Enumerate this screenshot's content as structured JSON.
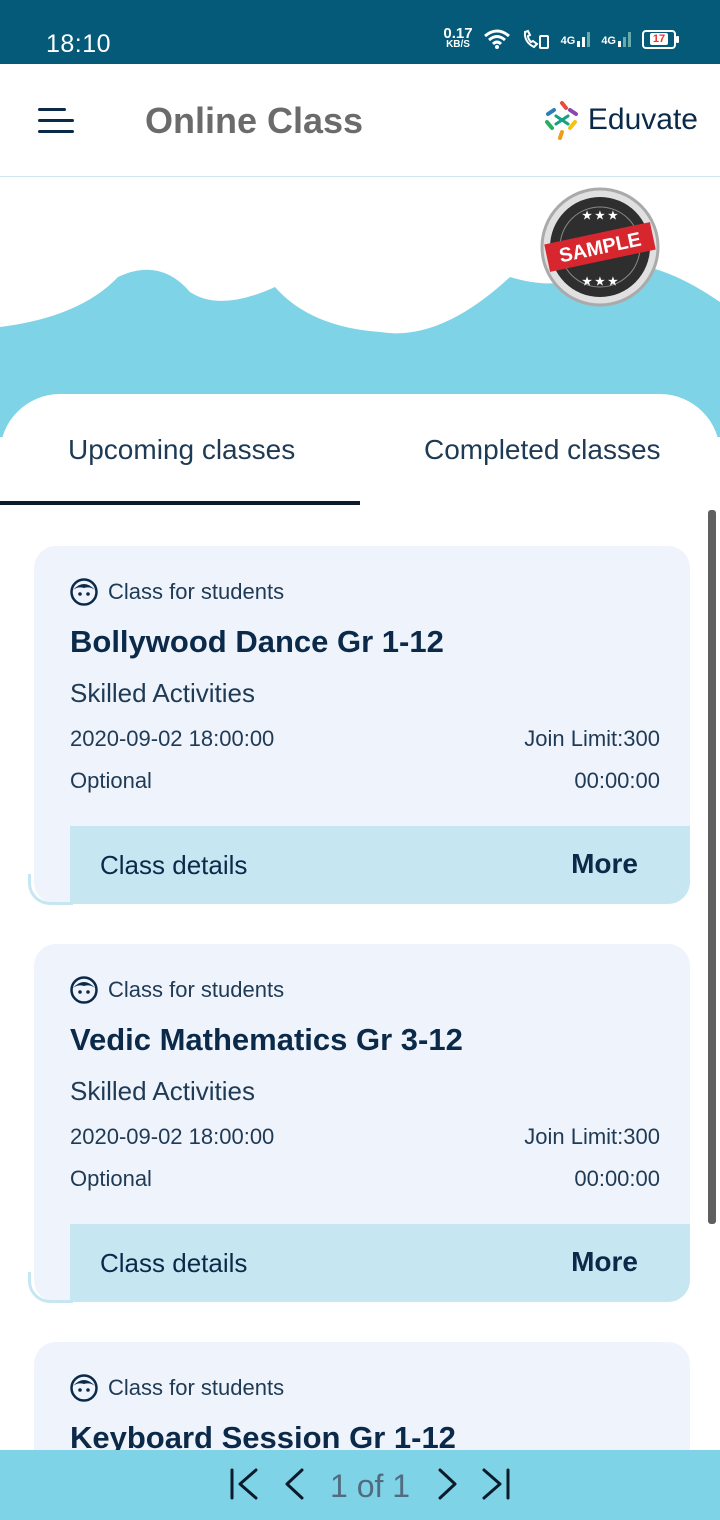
{
  "status_bar": {
    "time": "18:10",
    "net_speed_value": "0.17",
    "net_speed_unit": "KB/S",
    "signal1_label": "4G",
    "signal2_label": "4G",
    "battery_level": "17"
  },
  "app_bar": {
    "title": "Online Class",
    "brand_name": "Eduvate"
  },
  "tabs": [
    {
      "label": "Upcoming classes",
      "active": true
    },
    {
      "label": "Completed classes",
      "active": false
    }
  ],
  "classes": [
    {
      "audience": "Class for students",
      "title": "Bollywood Dance Gr 1-12",
      "category": "Skilled Activities",
      "datetime": "2020-09-02 18:00:00",
      "join_limit": "Join Limit:300",
      "requirement": "Optional",
      "duration": "00:00:00",
      "details_label": "Class details",
      "more_label": "More"
    },
    {
      "audience": "Class for students",
      "title": "Vedic Mathematics Gr 3-12",
      "category": "Skilled Activities",
      "datetime": "2020-09-02 18:00:00",
      "join_limit": "Join Limit:300",
      "requirement": "Optional",
      "duration": "00:00:00",
      "details_label": "Class details",
      "more_label": "More"
    },
    {
      "audience": "Class for students",
      "title": "Keyboard Session Gr 1-12"
    }
  ],
  "pager": {
    "label": "1 of 1"
  },
  "colors": {
    "status_bar": "#045a78",
    "accent_sky": "#7fd3e6",
    "card_bg": "#eff3fb",
    "card_footer": "#c6e7f1",
    "text_dark": "#0b2a4a"
  }
}
